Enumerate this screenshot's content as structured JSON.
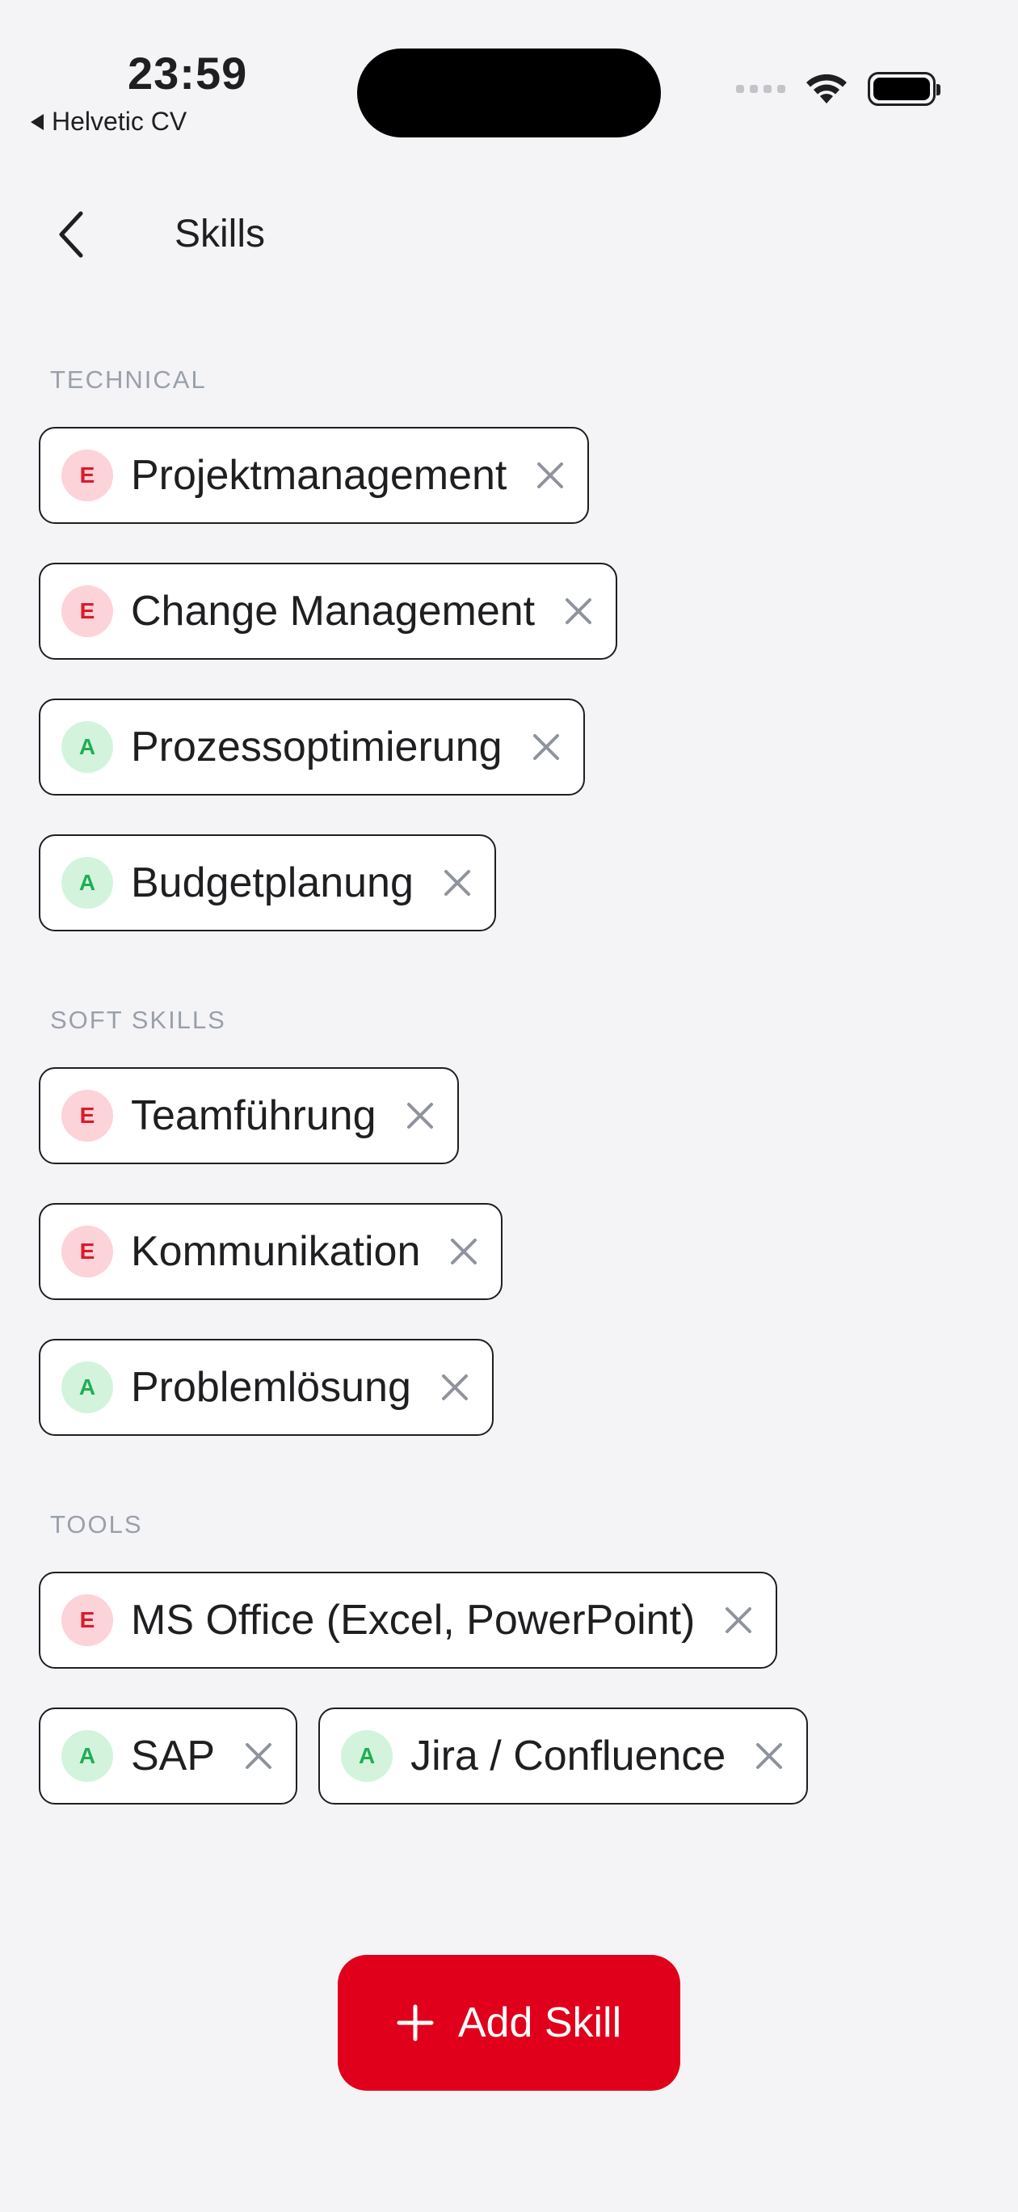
{
  "status_bar": {
    "time": "23:59",
    "back_app": "Helvetic CV"
  },
  "nav": {
    "title": "Skills"
  },
  "colors": {
    "accent": "#E0001B",
    "expert_badge_bg": "#FBD3D8",
    "expert_badge_fg": "#D81B2C",
    "advanced_badge_bg": "#D3F3DD",
    "advanced_badge_fg": "#1FAE52"
  },
  "sections": [
    {
      "title": "TECHNICAL",
      "skills": [
        {
          "level": "E",
          "name": "Projektmanagement"
        },
        {
          "level": "E",
          "name": "Change Management"
        },
        {
          "level": "A",
          "name": "Prozessoptimierung"
        },
        {
          "level": "A",
          "name": "Budgetplanung"
        }
      ]
    },
    {
      "title": "SOFT SKILLS",
      "skills": [
        {
          "level": "E",
          "name": "Teamführung"
        },
        {
          "level": "E",
          "name": "Kommunikation"
        },
        {
          "level": "A",
          "name": "Problemlösung"
        }
      ]
    },
    {
      "title": "TOOLS",
      "skills": [
        {
          "level": "E",
          "name": "MS Office (Excel, PowerPoint)"
        },
        {
          "level": "A",
          "name": "SAP"
        },
        {
          "level": "A",
          "name": "Jira / Confluence"
        }
      ]
    }
  ],
  "icons": {
    "back": "chevron-left-icon",
    "remove": "close-icon",
    "add": "plus-icon"
  },
  "add_button": {
    "label": "Add Skill"
  }
}
